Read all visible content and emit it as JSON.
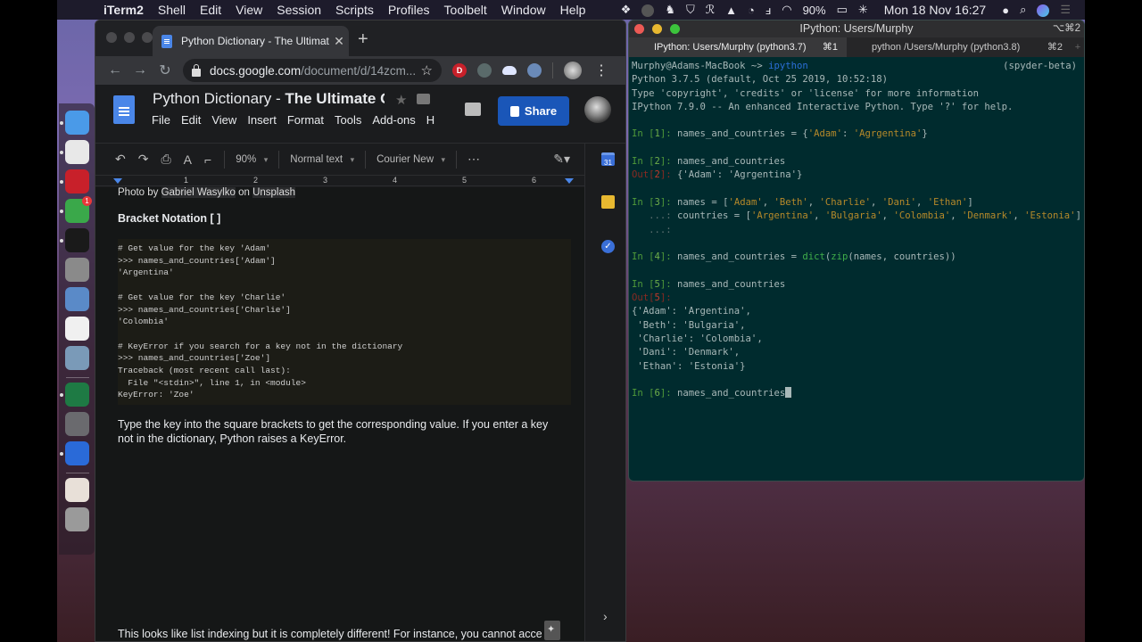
{
  "menubar": {
    "app_name": "iTerm2",
    "items": [
      "Shell",
      "Edit",
      "View",
      "Session",
      "Scripts",
      "Profiles",
      "Toolbelt",
      "Window",
      "Help"
    ],
    "battery": "90%",
    "datetime": "Mon 18 Nov  16:27",
    "status_icons": [
      "dropbox-icon",
      "evernote-icon",
      "shield-icon",
      "scribble-icon",
      "bell-icon",
      "timer-icon",
      "input-icon",
      "wifi-icon",
      "battery-icon",
      "flag-uk-icon",
      "user-icon",
      "spotlight-icon",
      "siri-icon",
      "notification-center-icon"
    ]
  },
  "dock": {
    "items": [
      {
        "name": "Finder",
        "color": "#4a9ae8",
        "running": true
      },
      {
        "name": "Google Chrome",
        "color": "#e8e8e8",
        "running": true
      },
      {
        "name": "ExpressVPN",
        "color": "#c8202a",
        "running": true
      },
      {
        "name": "Evernote",
        "color": "#3aa84a",
        "running": true,
        "badge": "1"
      },
      {
        "name": "iTerm2",
        "color": "#1a1a1a",
        "running": true
      },
      {
        "name": "Xcode Instruments",
        "color": "#8a8a8a",
        "running": false
      },
      {
        "name": "Preview",
        "color": "#5a8ac8",
        "running": false
      },
      {
        "name": "Slack",
        "color": "#f0f0f0",
        "running": false
      },
      {
        "name": "Image Capture",
        "color": "#7a9ab8",
        "running": false
      },
      {
        "name": "Microsoft Excel",
        "color": "#1e7a44",
        "running": true
      },
      {
        "name": "System Preferences",
        "color": "#6a6a6e",
        "running": false
      },
      {
        "name": "QuickTime Player",
        "color": "#2a6ad8",
        "running": true
      },
      {
        "name": "Downloads",
        "color": "#e8e0d8",
        "running": false
      },
      {
        "name": "Trash",
        "color": "#9a9a9a",
        "running": false
      }
    ]
  },
  "chrome": {
    "tab_title": "Python Dictionary - The Ultimate Guide",
    "url_host": "docs.google.com",
    "url_path": "/document/d/14zcm...",
    "extensions": [
      {
        "label": "D",
        "color": "#c8202a"
      },
      {
        "label": "",
        "color": "#5a6a6a"
      },
      {
        "label": "",
        "color": "#dfe6ff"
      },
      {
        "label": "",
        "color": "#6a8ab8"
      }
    ]
  },
  "docs": {
    "title_plain": "Python Dictionary - ",
    "title_bold": "The Ultimate Gu",
    "menu": [
      "File",
      "Edit",
      "View",
      "Insert",
      "Format",
      "Tools",
      "Add-ons",
      "H"
    ],
    "share_label": "Share",
    "zoom": "90%",
    "style": "Normal text",
    "font": "Courier New",
    "more": "⋯",
    "ruler_marks": [
      "1",
      "2",
      "3",
      "4",
      "5",
      "6"
    ],
    "caption_prefix": "Photo by ",
    "caption_author": "Gabriel Wasylko",
    "caption_mid": " on ",
    "caption_source": "Unsplash",
    "heading": "Bracket Notation [ ]",
    "code_lines": [
      "# Get value for the key 'Adam'",
      ">>> names_and_countries['Adam']",
      "'Argentina'",
      "",
      "# Get value for the key 'Charlie'",
      ">>> names_and_countries['Charlie']",
      "'Colombia'",
      "",
      "# KeyError if you search for a key not in the dictionary",
      ">>> names_and_countries['Zoe']",
      "Traceback (most recent call last):",
      "  File \"<stdin>\", line 1, in <module>",
      "KeyError: 'Zoe'"
    ],
    "paragraph": "Type the key into the square brackets to get the corresponding value. If you enter a key not in the dictionary, Python raises a KeyError.",
    "paragraph_bottom": "This looks like list indexing but it is completely different! For instance, you cannot access v",
    "side_calendar_label": "31"
  },
  "iterm": {
    "window_title": "IPython: Users/Murphy",
    "window_shortcut": "⌥⌘2",
    "tabs": [
      {
        "label": "IPython: Users/Murphy (python3.7)",
        "shortcut": "⌘1",
        "active": true
      },
      {
        "label": "python /Users/Murphy (python3.8)",
        "shortcut": "⌘2",
        "active": false
      }
    ],
    "prompt_user": "Murphy@Adams-MacBook ~> ",
    "prompt_cmd": "ipython",
    "env": "(spyder-beta)",
    "banner": [
      "Python 3.7.5 (default, Oct 25 2019, 10:52:18)",
      "Type 'copyright', 'credits' or 'license' for more information",
      "IPython 7.9.0 -- An enhanced Interactive Python. Type '?' for help."
    ],
    "cells": {
      "in1_num": "1",
      "in1_code_a": "names_and_countries = {",
      "in1_k": "'Adam'",
      "in1_sep": ": ",
      "in1_v": "'Agrgentina'",
      "in1_end": "}",
      "in2_num": "2",
      "in2_code": "names_and_countries",
      "out2_num": "2",
      "out2_val": "{'Adam': 'Agrgentina'}",
      "in3_num": "3",
      "in3_line1_pre": "names = [",
      "in3_names": [
        "'Adam'",
        "'Beth'",
        "'Charlie'",
        "'Dani'",
        "'Ethan'"
      ],
      "in3_line2_pre": "countries = [",
      "in3_countries": [
        "'Argentina'",
        "'Bulgaria'",
        "'Colombia'",
        "'Denmark'",
        "'Estonia'"
      ],
      "in4_num": "4",
      "in4_pre": "names_and_countries = ",
      "in4_dict": "dict",
      "in4_paren": "(",
      "in4_zip": "zip",
      "in4_args": "(names, countries))",
      "in5_num": "5",
      "in5_code": "names_and_countries",
      "out5_num": "5",
      "out5_lines": [
        "{'Adam': 'Argentina',",
        " 'Beth': 'Bulgaria',",
        " 'Charlie': 'Colombia',",
        " 'Dani': 'Denmark',",
        " 'Ethan': 'Estonia'}"
      ],
      "in6_num": "6",
      "in6_code": "names_and_countries"
    }
  }
}
